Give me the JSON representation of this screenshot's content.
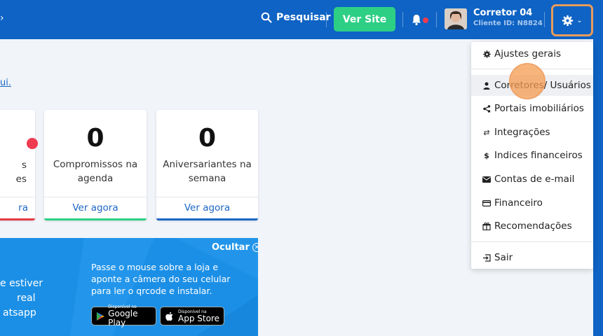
{
  "header": {
    "search_label": "Pesquisar",
    "view_site_label": "Ver Site",
    "user_name": "Corretor 04",
    "client_id": "Cliente ID: N8824"
  },
  "main": {
    "link_text": "ui.",
    "cards": [
      {
        "value": "",
        "label_line1": "s",
        "label_line2": "es",
        "cta": "ra",
        "accent": "#e53946"
      },
      {
        "value": "0",
        "label_line1": "Compromissos na",
        "label_line2": "agenda",
        "cta": "Ver agora",
        "accent": "#2dcf85"
      },
      {
        "value": "0",
        "label_line1": "Aniversariantes na",
        "label_line2": "semana",
        "cta": "Ver agora",
        "accent": "#1c66c4"
      }
    ]
  },
  "promo": {
    "hide_label": "Ocultar",
    "left_line1": "e estiver",
    "left_line2": "real",
    "left_line3": "atsapp",
    "instruction": "Passe o mouse sobre a loja e aponte a câmera do seu celular para ler o qrcode e instalar.",
    "google_small": "Disponível no",
    "google_big": "Google Play",
    "apple_small": "Disponível na",
    "apple_big": "App Store"
  },
  "dropdown": {
    "items": [
      {
        "label": "Ajustes gerais",
        "icon": "gear-icon"
      },
      {
        "label": "Corretores/ Usuários",
        "icon": "user-icon"
      },
      {
        "label": "Portais imobiliários",
        "icon": "share-icon"
      },
      {
        "label": "Integrações",
        "icon": "swap-icon"
      },
      {
        "label": "Indices financeiros",
        "icon": "dollar-icon"
      },
      {
        "label": "Contas de e-mail",
        "icon": "mail-icon"
      },
      {
        "label": "Financeiro",
        "icon": "credit-card-icon"
      },
      {
        "label": "Recomendações",
        "icon": "gift-icon"
      },
      {
        "label": "Sair",
        "icon": "logout-icon"
      }
    ]
  },
  "colors": {
    "topbar": "#0e63c4",
    "accent_green": "#2dcf85",
    "highlight_orange": "#e89b5a"
  }
}
